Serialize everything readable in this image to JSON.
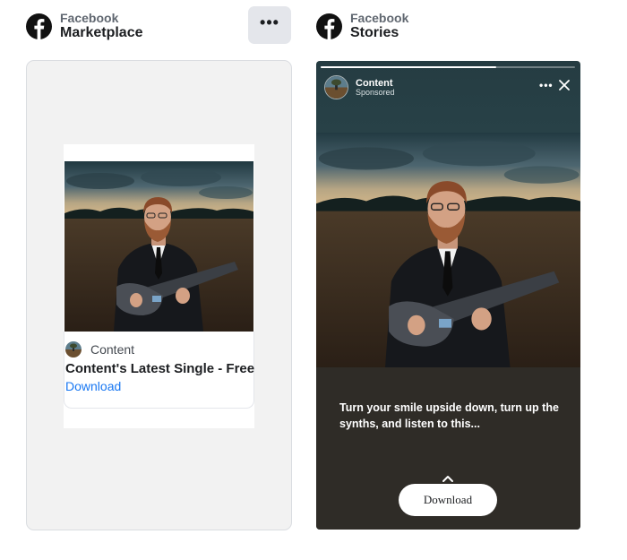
{
  "marketplace": {
    "platform": "Facebook",
    "placement": "Marketplace",
    "more_label": "•••",
    "ad": {
      "advertiser": "Content",
      "headline": "Content's Latest Single - Free",
      "cta": "Download"
    }
  },
  "stories": {
    "platform": "Facebook",
    "placement": "Stories",
    "advertiser": "Content",
    "sponsored": "Sponsored",
    "more_label": "•••",
    "progress": 0.69,
    "primary_text": "Turn your smile upside down, turn up the synths, and listen to this...",
    "cta": "Download"
  },
  "icons": {
    "logo": "facebook-logo-icon",
    "more": "more-options-icon",
    "close": "close-icon",
    "chevron": "chevron-up-icon"
  },
  "colors": {
    "link": "#1877f2",
    "story_bg": "#2f2c27",
    "frame_bg": "#f2f2f2"
  }
}
